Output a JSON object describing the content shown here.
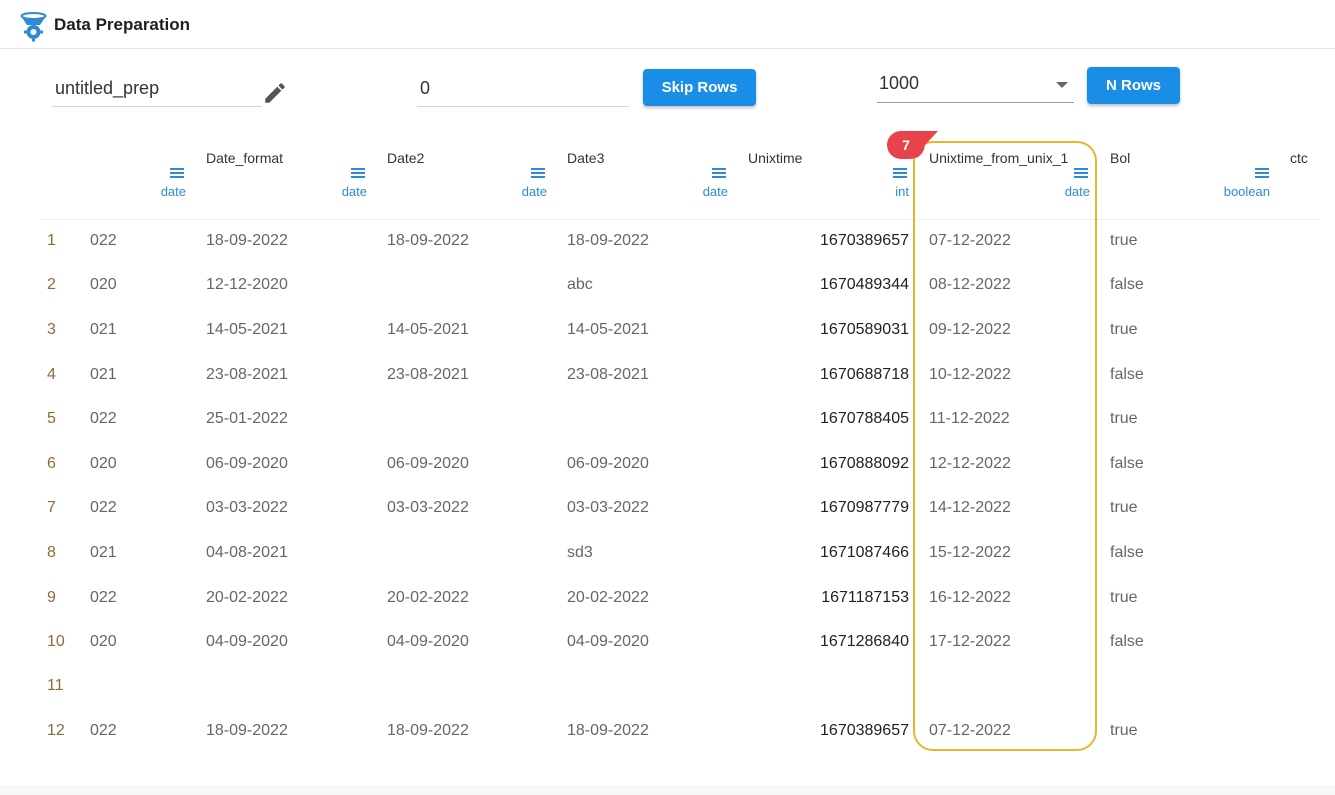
{
  "app": {
    "title": "Data Preparation",
    "logo_icon": "data-prep-logo-icon"
  },
  "toolbar": {
    "prep_name": "untitled_prep",
    "skip_rows_value": "0",
    "skip_rows_label": "Skip Rows",
    "n_rows_value": "1000",
    "n_rows_label": "N Rows"
  },
  "columns": [
    {
      "name": "",
      "type": "date"
    },
    {
      "name": "Date_format",
      "type": "date"
    },
    {
      "name": "Date2",
      "type": "date"
    },
    {
      "name": "Date3",
      "type": "date"
    },
    {
      "name": "Unixtime",
      "type": "int"
    },
    {
      "name": "Unixtime_from_unix_1",
      "type": "date"
    },
    {
      "name": "Bol",
      "type": "boolean"
    },
    {
      "name": "ctc",
      "type": ""
    }
  ],
  "rows": [
    {
      "num": "1",
      "c0": "022",
      "c1": "18-09-2022",
      "c2": "18-09-2022",
      "c3": "18-09-2022",
      "c4": "1670389657",
      "c5": "07-12-2022",
      "c6": "true"
    },
    {
      "num": "2",
      "c0": "020",
      "c1": "12-12-2020",
      "c2": "",
      "c3": "abc",
      "c4": "1670489344",
      "c5": "08-12-2022",
      "c6": "false"
    },
    {
      "num": "3",
      "c0": "021",
      "c1": "14-05-2021",
      "c2": "14-05-2021",
      "c3": "14-05-2021",
      "c4": "1670589031",
      "c5": "09-12-2022",
      "c6": "true"
    },
    {
      "num": "4",
      "c0": "021",
      "c1": "23-08-2021",
      "c2": "23-08-2021",
      "c3": "23-08-2021",
      "c4": "1670688718",
      "c5": "10-12-2022",
      "c6": "false"
    },
    {
      "num": "5",
      "c0": "022",
      "c1": "25-01-2022",
      "c2": "",
      "c3": "",
      "c4": "1670788405",
      "c5": "11-12-2022",
      "c6": "true"
    },
    {
      "num": "6",
      "c0": "020",
      "c1": "06-09-2020",
      "c2": "06-09-2020",
      "c3": "06-09-2020",
      "c4": "1670888092",
      "c5": "12-12-2022",
      "c6": "false"
    },
    {
      "num": "7",
      "c0": "022",
      "c1": "03-03-2022",
      "c2": "03-03-2022",
      "c3": "03-03-2022",
      "c4": "1670987779",
      "c5": "14-12-2022",
      "c6": "true"
    },
    {
      "num": "8",
      "c0": "021",
      "c1": "04-08-2021",
      "c2": "",
      "c3": "sd3",
      "c4": "1671087466",
      "c5": "15-12-2022",
      "c6": "false"
    },
    {
      "num": "9",
      "c0": "022",
      "c1": "20-02-2022",
      "c2": "20-02-2022",
      "c3": "20-02-2022",
      "c4": "1671187153",
      "c5": "16-12-2022",
      "c6": "true"
    },
    {
      "num": "10",
      "c0": "020",
      "c1": "04-09-2020",
      "c2": "04-09-2020",
      "c3": "04-09-2020",
      "c4": "1671286840",
      "c5": "17-12-2022",
      "c6": "false"
    },
    {
      "num": "11",
      "c0": "",
      "c1": "",
      "c2": "",
      "c3": "",
      "c4": "",
      "c5": "",
      "c6": ""
    },
    {
      "num": "12",
      "c0": "022",
      "c1": "18-09-2022",
      "c2": "18-09-2022",
      "c3": "18-09-2022",
      "c4": "1670389657",
      "c5": "07-12-2022",
      "c6": "true"
    }
  ],
  "annotation": {
    "step_number": "7",
    "highlight_color": "#e9b62a",
    "badge_color": "#e8424b"
  },
  "colors": {
    "accent": "#1a8ee6",
    "type_label": "#2c8bd2",
    "row_number": "#8a6d3b"
  }
}
